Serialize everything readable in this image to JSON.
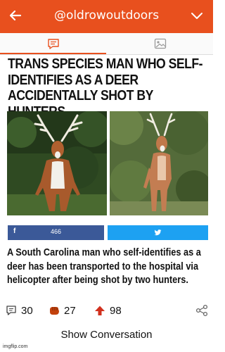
{
  "header": {
    "handle": "@oldrowoutdoors",
    "accent_color": "#e8501e",
    "back_icon": "arrow-left-icon",
    "menu_icon": "chevron-down-icon"
  },
  "tabs": [
    {
      "name": "text-tab",
      "icon": "text-bubble-icon",
      "active": true
    },
    {
      "name": "image-tab",
      "icon": "image-icon",
      "active": false
    }
  ],
  "post": {
    "headline": "TRANS SPECIES MAN WHO SELF-IDENTIFIES AS A DEER ACCIDENTALLY SHOT BY HUNTERS",
    "body": "A South Carolina man who self-identifies as a deer has been transported to the hospital via helicopter after being shot by two hunters.",
    "share": {
      "facebook_label": "f",
      "facebook_count": "466",
      "facebook_color": "#3b5998",
      "twitter_color": "#1da1f2"
    }
  },
  "stats": {
    "replies": "30",
    "likes": "27",
    "reblogs": "98"
  },
  "show_conversation": "Show Conversation",
  "watermark": "imgflip.com"
}
